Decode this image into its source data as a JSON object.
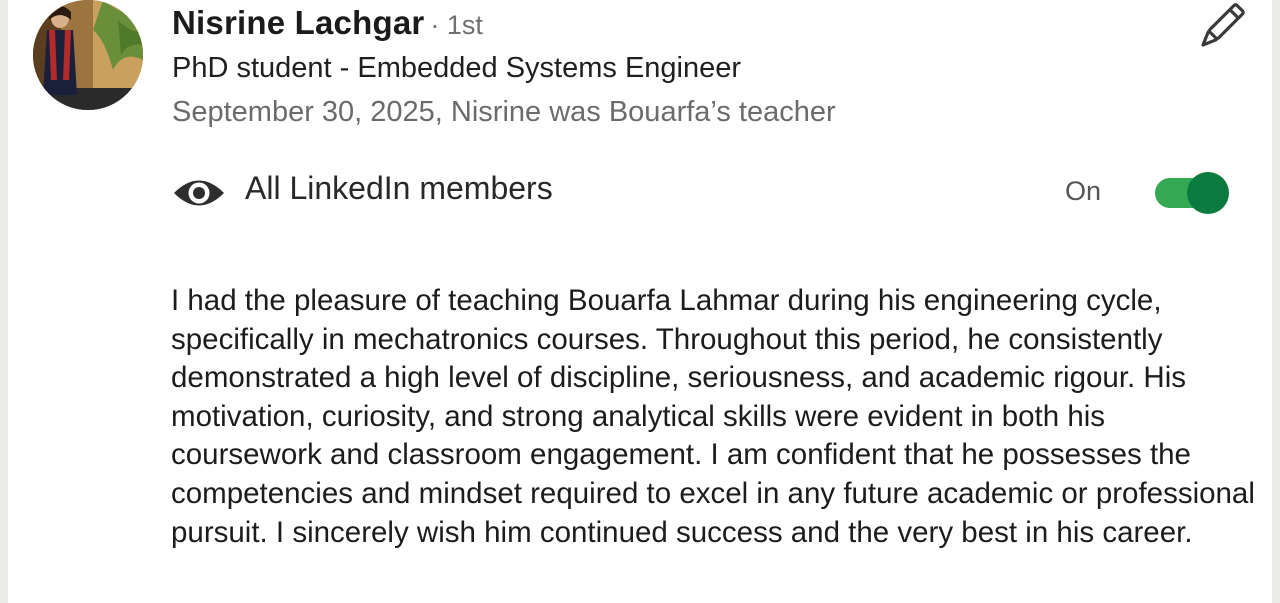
{
  "recommendation": {
    "author": {
      "name": "Nisrine Lachgar",
      "degree": "· 1st",
      "headline": "PhD student - Embedded Systems Engineer",
      "relation": "September 30, 2025, Nisrine was Bouarfa’s teacher",
      "avatar_icon": "profile-photo"
    },
    "edit_icon": "pencil-icon",
    "visibility": {
      "icon": "eye-icon",
      "label": "All LinkedIn members",
      "state_label": "On",
      "enabled": true,
      "accent_color": "#0b7a3e"
    },
    "text": "I had the pleasure of teaching Bouarfa Lahmar during his engineering cycle, specifically in mechatronics courses. Throughout this period, he consistently demonstrated a high level of discipline, seriousness, and academic rigour. His motivation, curiosity, and strong analytical skills were evident in both his coursework and classroom engagement. I am confident that he possesses the competencies and mindset required to excel in any future academic or professional pursuit. I sincerely wish him continued success and the very best in his career."
  }
}
